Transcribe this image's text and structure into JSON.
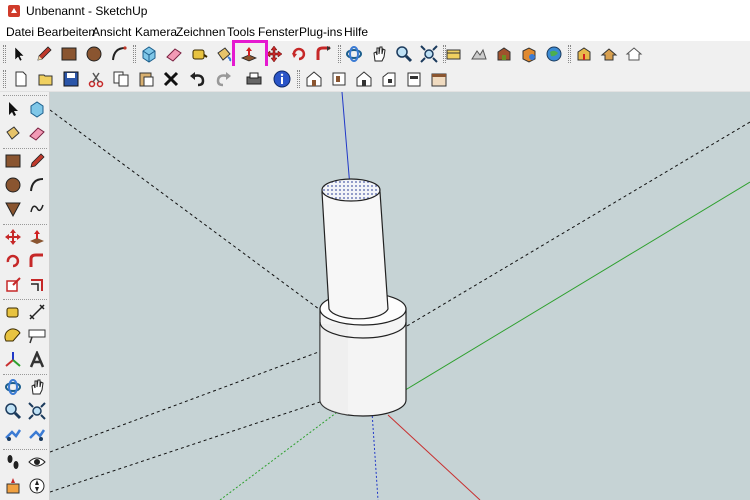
{
  "window": {
    "title": "Unbenannt - SketchUp"
  },
  "menu": [
    "Datei",
    "Bearbeiten",
    "Ansicht",
    "Kamera",
    "Zeichnen",
    "Tools",
    "Fenster",
    "Plug-ins",
    "Hilfe"
  ],
  "toolbar_top": [
    "select-tool",
    "pencil-tool",
    "rectangle-tool",
    "circle-tool",
    "arc-tool",
    "make-component-tool",
    "eraser-tool",
    "tape-measure-tool",
    "paint-bucket-tool",
    "push-pull-tool",
    "move-tool",
    "rotate-tool",
    "follow-me-tool",
    "orbit-tool",
    "pan-tool",
    "zoom-tool",
    "zoom-extents-tool",
    "previous-view-tool",
    "next-view-tool",
    "add-location-tool",
    "toggle-terrain-tool",
    "photo-textures-tool",
    "get-models-tool",
    "share-model-tool",
    "share-component-tool"
  ],
  "toolbar_second": [
    "new-file",
    "open-file",
    "save-file",
    "cut",
    "copy",
    "paste",
    "delete",
    "undo",
    "redo",
    "print",
    "model-info",
    "iso-view",
    "top-view",
    "front-view",
    "right-view",
    "back-view",
    "left-view"
  ],
  "left_toolbar": [
    "select-tool",
    "make-component-tool",
    "paint-bucket-tool",
    "eraser-tool",
    "rectangle-tool",
    "line-tool",
    "circle-tool",
    "arc-tool",
    "polygon-tool",
    "freehand-tool",
    "move-tool",
    "push-pull-tool",
    "rotate-tool",
    "follow-me-tool",
    "scale-tool",
    "offset-tool",
    "tape-measure-tool",
    "dimension-tool",
    "protractor-tool",
    "text-tool",
    "axes-tool",
    "3d-text-tool",
    "orbit-tool",
    "pan-tool",
    "zoom-tool",
    "zoom-window-tool",
    "zoom-extents-tool",
    "previous-view-tool",
    "walk-tool",
    "look-around-tool",
    "section-plane-tool",
    "position-camera-tool"
  ],
  "colors": {
    "highlight": "#e51ad0",
    "viewport_bg": "#c6d3d5",
    "axis_blue": "#2038c8",
    "axis_green": "#2ea02e",
    "axis_red": "#c83030"
  }
}
